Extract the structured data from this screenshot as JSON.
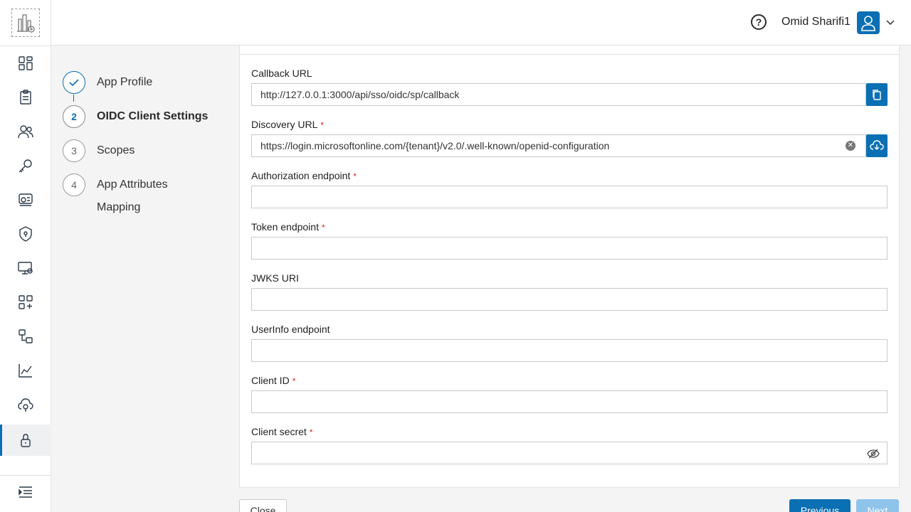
{
  "header": {
    "user_name": "Omid Sharifi1",
    "help_glyph": "?"
  },
  "rail": {
    "items": [
      {
        "icon": "dashboard-icon"
      },
      {
        "icon": "clipboard-icon"
      },
      {
        "icon": "users-icon"
      },
      {
        "icon": "key-icon"
      },
      {
        "icon": "identity-card-icon"
      },
      {
        "icon": "shield-icon"
      },
      {
        "icon": "monitor-settings-icon"
      },
      {
        "icon": "apps-add-icon"
      },
      {
        "icon": "flow-icon"
      },
      {
        "icon": "analytics-icon"
      },
      {
        "icon": "cloud-sync-icon"
      },
      {
        "icon": "lock-icon",
        "active": true
      }
    ],
    "collapse_icon": "menu-collapse-icon"
  },
  "stepper": {
    "steps": [
      {
        "number": "",
        "label": "App Profile",
        "state": "done"
      },
      {
        "number": "2",
        "label": "OIDC Client Settings",
        "state": "current"
      },
      {
        "number": "3",
        "label": "Scopes",
        "state": "pending"
      },
      {
        "number": "4",
        "label": "App Attributes Mapping",
        "state": "pending"
      }
    ]
  },
  "form": {
    "callback_url": {
      "label": "Callback URL",
      "value": "http://127.0.0.1:3000/api/sso/oidc/sp/callback"
    },
    "discovery_url": {
      "label": "Discovery URL",
      "value": "https://login.microsoftonline.com/{tenant}/v2.0/.well-known/openid-configuration"
    },
    "authorization_endpoint": {
      "label": "Authorization endpoint",
      "value": ""
    },
    "token_endpoint": {
      "label": "Token endpoint",
      "value": ""
    },
    "jwks_uri": {
      "label": "JWKS URI",
      "value": ""
    },
    "userinfo_endpoint": {
      "label": "UserInfo endpoint",
      "value": ""
    },
    "client_id": {
      "label": "Client ID",
      "value": ""
    },
    "client_secret": {
      "label": "Client secret",
      "value": ""
    },
    "required_marker": "*"
  },
  "footer": {
    "close_label": "Close",
    "previous_label": "Previous",
    "next_label": "Next"
  },
  "colors": {
    "accent": "#0a6fb3",
    "accent_disabled": "#8ec4ea",
    "required": "#dd2222"
  }
}
